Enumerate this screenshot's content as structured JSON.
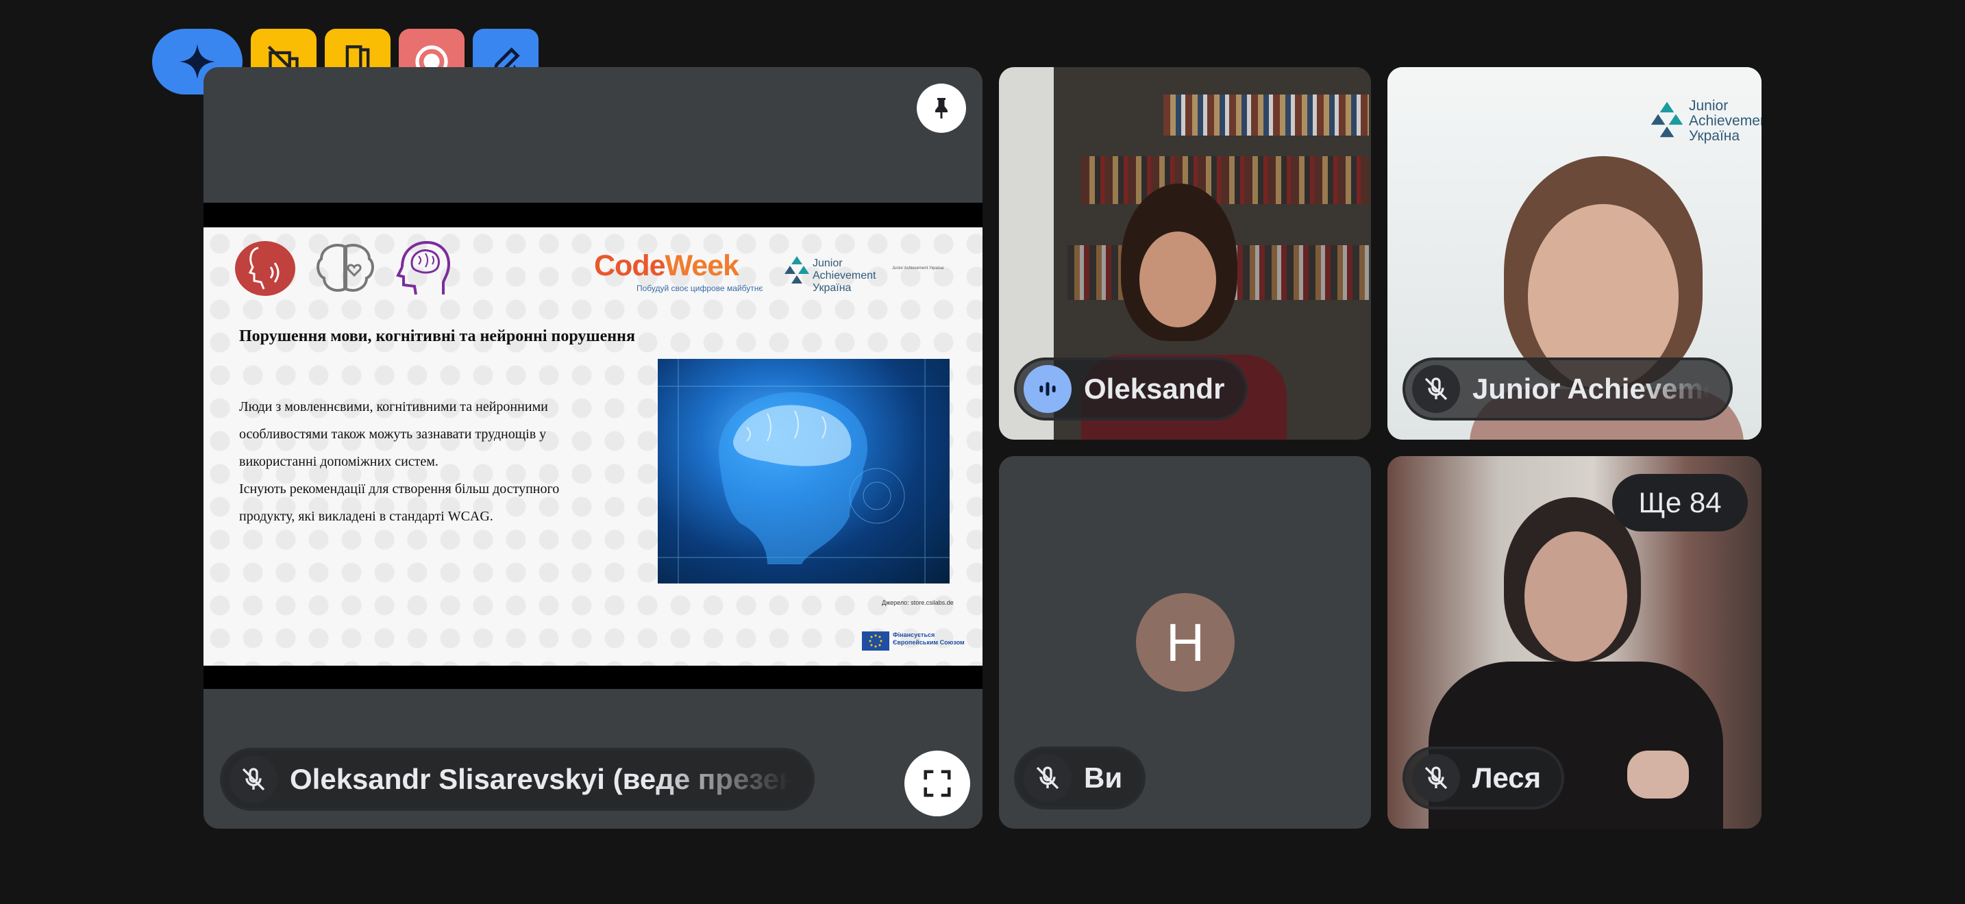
{
  "toolbar": {
    "buttons": [
      {
        "name": "gemini-button",
        "icon": "sparkle-icon",
        "color": "#3a86f0"
      },
      {
        "name": "hide-tiles-button",
        "icon": "hide-tiles-icon",
        "color": "#fbbc04"
      },
      {
        "name": "breakout-rooms-button",
        "icon": "door-icon",
        "color": "#fbbc04"
      },
      {
        "name": "recording-button",
        "icon": "record-icon",
        "color": "#e8706f"
      },
      {
        "name": "whiteboard-button",
        "icon": "pen-icon",
        "color": "#3a86f0"
      }
    ]
  },
  "presentation": {
    "presenter_label": "Oleksandr Slisarevskyi (веде презентацію)",
    "slide": {
      "title": "Порушення мови, когнітивні та нейронні порушення",
      "body": [
        "Люди з мовленнєвими, когнітивними та нейронними",
        "особливостями також можуть зазнавати труднощів у",
        "використанні допоміжних систем.",
        "Існують рекомендації для створення більш доступного",
        "продукту, які викладені в стандарті WCAG."
      ],
      "codeweek_logo": "CodeWeek",
      "codeweek_tagline": "Побудуй своє цифрове майбутнє",
      "ja_logo": [
        "Junior",
        "Achievement",
        "Україна"
      ],
      "ja_small": "Junior Achievement Україна",
      "source": "Джерело: store.csilabs.de",
      "eu_text": [
        "Фінансується",
        "Європейським Союзом"
      ]
    }
  },
  "participants": [
    {
      "name": "Oleksandr",
      "speaking": true
    },
    {
      "name": "Junior Achievement Україна",
      "muted": true,
      "logo": [
        "Junior",
        "Achievement",
        "Україна"
      ]
    },
    {
      "name": "Ви",
      "muted": true,
      "avatar_letter": "Н",
      "avatar_color": "#8d6e63"
    },
    {
      "name": "Леся",
      "muted": true,
      "more_label": "Ще 84"
    }
  ],
  "colors": {
    "background": "#141414",
    "tile": "#3c4043",
    "speaking": "#8ab4f8"
  }
}
